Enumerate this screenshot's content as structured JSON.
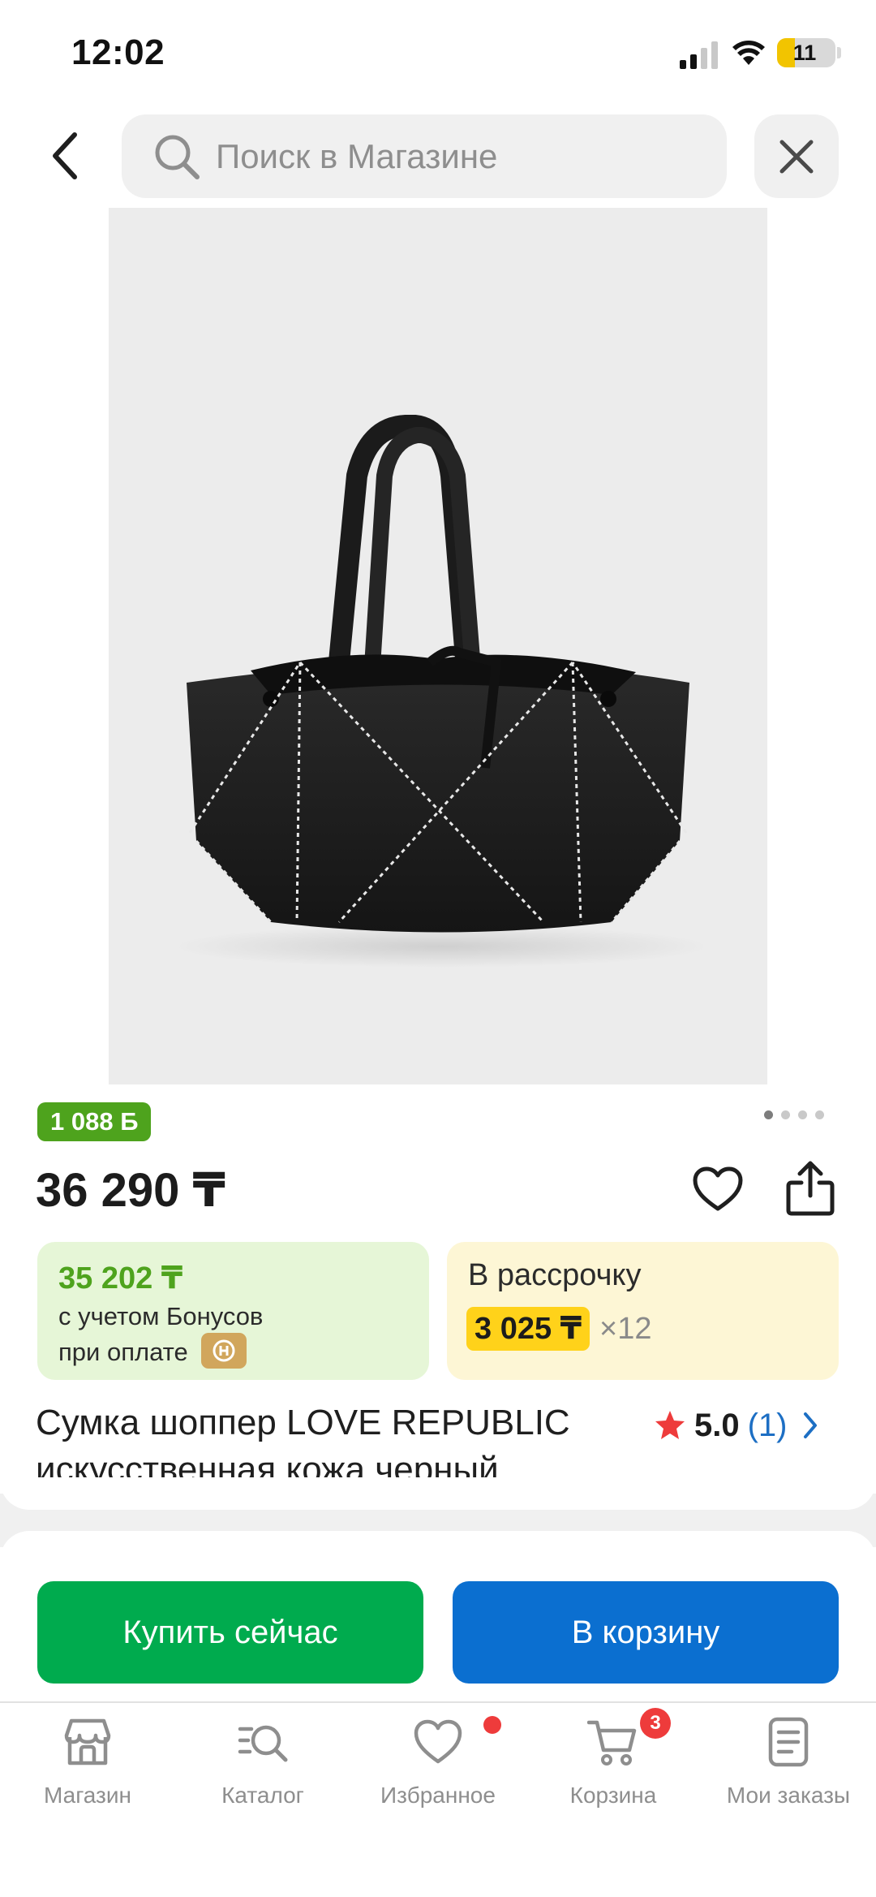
{
  "status_bar": {
    "time": "12:02",
    "battery": "11",
    "battery_level_percent": 11,
    "icons": [
      "cellular-signal-icon",
      "wifi-icon",
      "battery-icon"
    ]
  },
  "header": {
    "search_placeholder": "Поиск в Магазине",
    "back_icon": "chevron-left-icon",
    "close_icon": "close-icon"
  },
  "gallery": {
    "page_count": 4,
    "current_page": 1
  },
  "product": {
    "bonus_badge": "1 088 Б",
    "price": "36 290 ₸",
    "bonus_card": {
      "price": "35 202 ₸",
      "line1": "с учетом Бонусов",
      "line2": "при оплате"
    },
    "installment": {
      "title": "В рассрочку",
      "monthly": "3 025 ₸",
      "months": "×12"
    },
    "title_line1": "Сумка шоппер LOVE REPUBLIC",
    "title_line2": "искусственная кожа черный",
    "rating": "5.0",
    "reviews": "(1)"
  },
  "actions": {
    "buy_now": "Купить сейчас",
    "add_to_cart": "В корзину"
  },
  "bottom_nav": {
    "items": [
      {
        "label": "Магазин",
        "icon": "store-icon"
      },
      {
        "label": "Каталог",
        "icon": "catalog-search-icon"
      },
      {
        "label": "Избранное",
        "icon": "heart-icon"
      },
      {
        "label": "Корзина",
        "icon": "cart-icon"
      },
      {
        "label": "Мои заказы",
        "icon": "orders-icon"
      }
    ],
    "cart_badge": "3"
  },
  "colors": {
    "green_accent": "#4ea31d",
    "buy_button": "#00ab4e",
    "cart_button": "#0b6fd0",
    "installment_highlight": "#ffd21a",
    "badge_red": "#ee3b3b",
    "link_blue": "#1d6fc4"
  }
}
